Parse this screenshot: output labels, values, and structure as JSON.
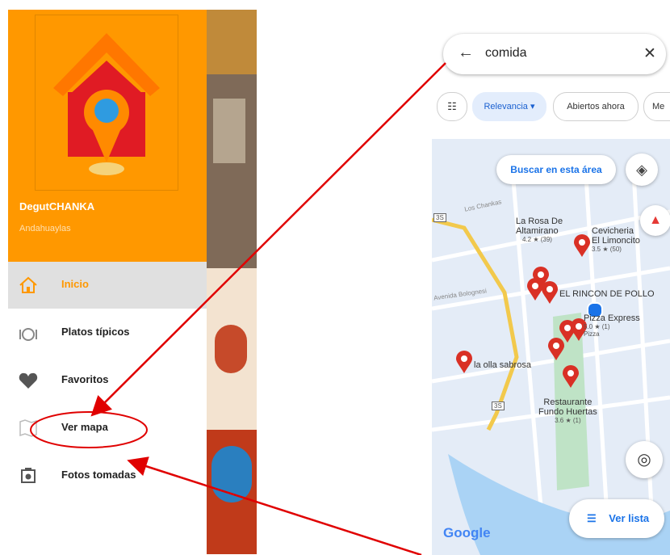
{
  "drawer": {
    "app_name": "DegutCHANKA",
    "app_city": "Andahuaylas",
    "items": [
      {
        "label": "Inicio",
        "icon": "home-icon"
      },
      {
        "label": "Platos típicos",
        "icon": "food-icon"
      },
      {
        "label": "Favoritos",
        "icon": "heart-icon"
      },
      {
        "label": "Ver mapa",
        "icon": "map-icon"
      },
      {
        "label": "Fotos tomadas",
        "icon": "camera-icon"
      }
    ]
  },
  "maps": {
    "search_query": "comida",
    "chips": [
      "Relevancia",
      "Abiertos ahora",
      "Me"
    ],
    "search_area_button": "Buscar en esta área",
    "list_button": "Ver lista",
    "logo": "Google",
    "streets": [
      "Los Chankas",
      "Avenida Bolognesi"
    ],
    "road_shields": [
      "3S",
      "3S"
    ],
    "places": [
      {
        "name_line1": "La Rosa De",
        "name_line2": "Altamirano",
        "rating": "4.2 ★ (39)"
      },
      {
        "name_line1": "Cevicheria",
        "name_line2": "El Limoncito",
        "rating": "3.5 ★ (50)"
      },
      {
        "name_line1": "EL RINCON DE POLLO"
      },
      {
        "name_line1": "Pizza Express",
        "rating": "5.0 ★ (1)",
        "category": "Pizza"
      },
      {
        "name_line1": "la olla sabrosa"
      },
      {
        "name_line1": "Restaurante",
        "name_line2": "Fundo Huertas",
        "rating": "3.6 ★ (1)"
      }
    ]
  },
  "colors": {
    "drawer_orange": "#FF9800",
    "accent_blue": "#1a73e8",
    "pin_red": "#d93025",
    "arrow_red": "#e00000"
  }
}
